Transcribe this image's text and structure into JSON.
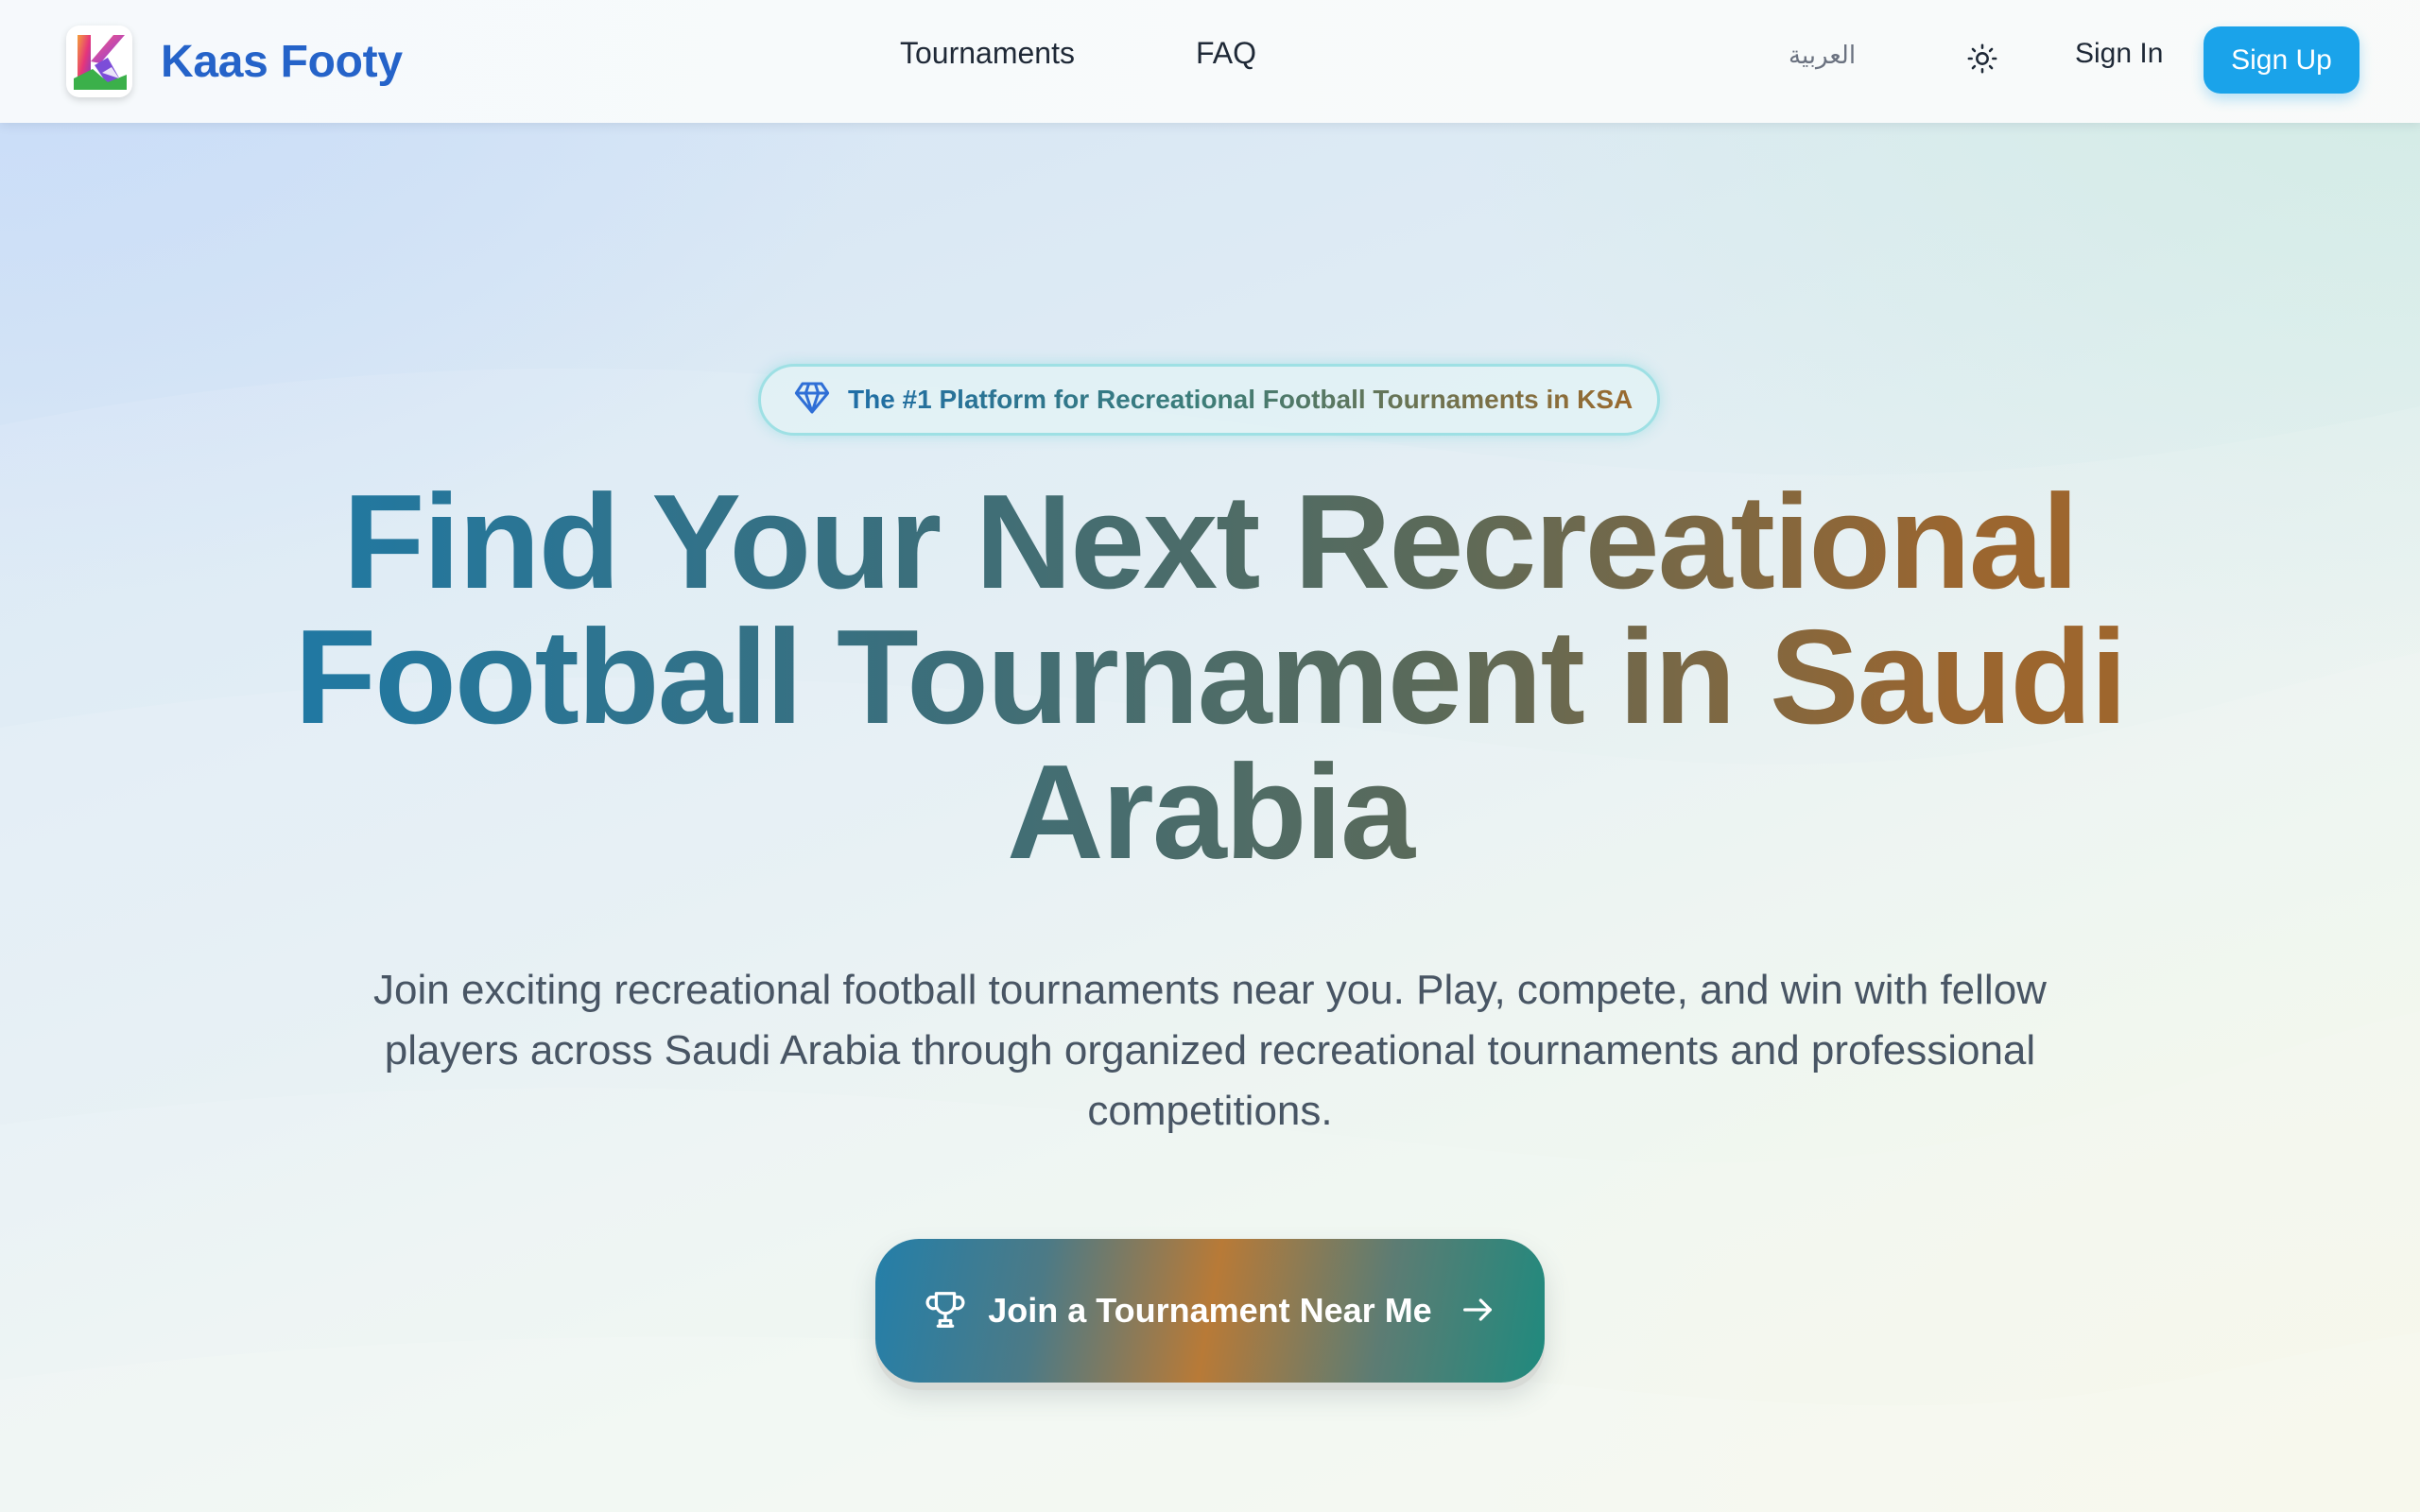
{
  "nav": {
    "brand": "Kaas Footy",
    "links": [
      {
        "label": "Tournaments"
      },
      {
        "label": "FAQ"
      }
    ],
    "language": "العربية",
    "sign_in": "Sign In",
    "sign_up": "Sign Up"
  },
  "hero": {
    "badge": "The #1 Platform for Recreational Football Tournaments in KSA",
    "headline_lines": [
      "Find Your Next Recreational",
      "Football Tournament in Saudi",
      "Arabia"
    ],
    "subheadline": "Join exciting recreational football tournaments near you. Play, compete, and win with fellow players across Saudi Arabia through organized recreational tournaments and professional competitions.",
    "cta": "Join a Tournament Near Me"
  },
  "icons": {
    "logo": "k-logo-icon",
    "theme": "sun-icon",
    "badge": "diamond-icon",
    "cta_left": "trophy-icon",
    "cta_right": "arrow-right-icon"
  },
  "colors": {
    "brand": "#2563c9",
    "signup_bg": "#1aa3ea",
    "badge_border": "#9ee0e4"
  }
}
